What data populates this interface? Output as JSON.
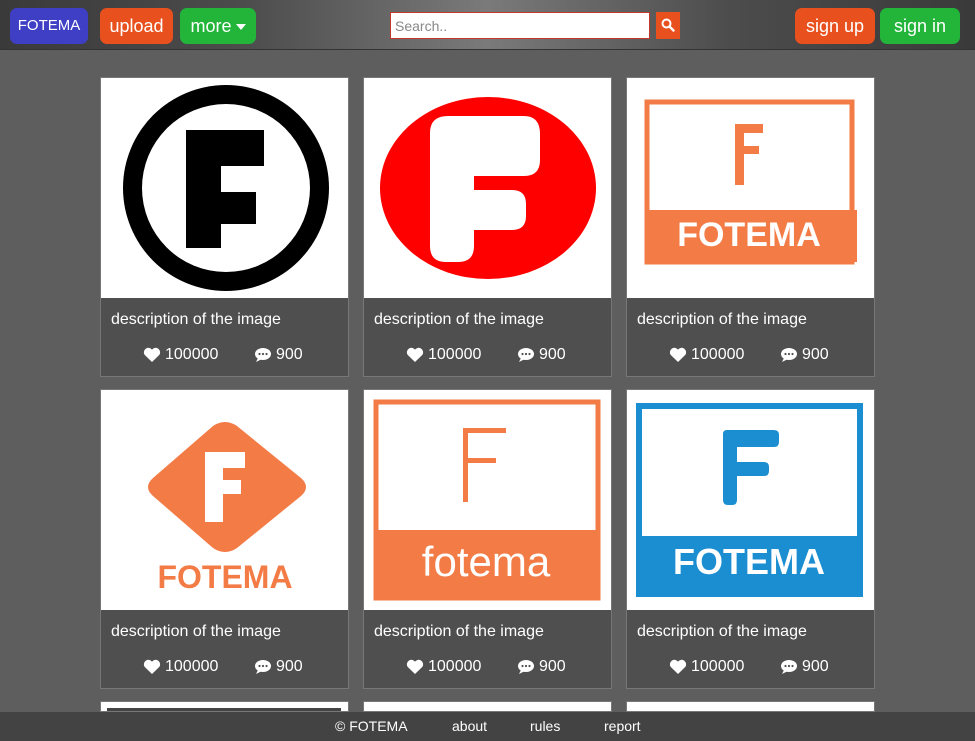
{
  "nav": {
    "brand": "FOTEMA",
    "upload": "upload",
    "more": "more",
    "signup": "sign up",
    "signin": "sign in",
    "search_placeholder": "Search..",
    "colors": {
      "orange": "#e8511e",
      "green": "#22b53a",
      "blue": "#3f3fc6"
    }
  },
  "cards": [
    {
      "image": "black F in black ring logo",
      "desc": "description of the image",
      "likes": "100000",
      "comments": "900"
    },
    {
      "image": "white F on red oval logo",
      "desc": "description of the image",
      "likes": "100000",
      "comments": "900"
    },
    {
      "image": "orange framed F with FOTEMA band",
      "logo_text": "FOTEMA",
      "desc": "description of the image",
      "likes": "100000",
      "comments": "900"
    },
    {
      "image": "orange diamond F with FOTEMA text",
      "logo_text": "FOTEMA",
      "desc": "description of the image",
      "likes": "100000",
      "comments": "900"
    },
    {
      "image": "thin orange F with fotema band",
      "logo_text": "fotema",
      "desc": "description of the image",
      "likes": "100000",
      "comments": "900"
    },
    {
      "image": "blue framed F with FOTEMA band",
      "logo_text": "FOTEMA",
      "desc": "description of the image",
      "likes": "100000",
      "comments": "900"
    }
  ],
  "footer": {
    "copyright": "© FOTEMA",
    "about": "about",
    "rules": "rules",
    "report": "report"
  }
}
